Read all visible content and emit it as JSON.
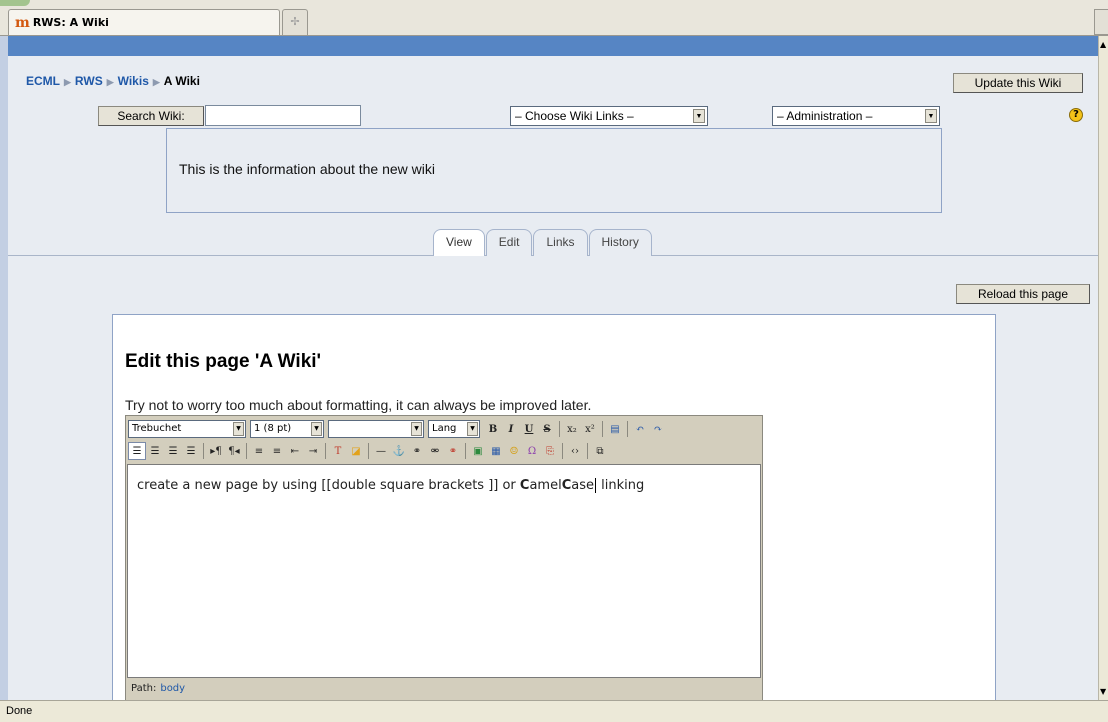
{
  "browser": {
    "tab_title": "RWS: A Wiki",
    "tab_logo": "m",
    "new_tab_icon": "✢",
    "status": "Done"
  },
  "breadcrumb": {
    "items": [
      "ECML",
      "RWS",
      "Wikis"
    ],
    "current": "A Wiki"
  },
  "header": {
    "update_button": "Update this Wiki",
    "search_button": "Search Wiki:",
    "search_value": "",
    "wiki_links_select": "– Choose Wiki Links –",
    "admin_select": "– Administration –",
    "help_icon": "?",
    "info_text": "This is the information about the new wiki"
  },
  "tabs": [
    {
      "label": "View",
      "active": true
    },
    {
      "label": "Edit",
      "active": false
    },
    {
      "label": "Links",
      "active": false
    },
    {
      "label": "History",
      "active": false
    }
  ],
  "reload_button": "Reload this page",
  "edit": {
    "title": "Edit this page 'A Wiki'",
    "hint": "Try not to worry too much about formatting, it can always be improved later.",
    "font_select": "Trebuchet",
    "size_select": "1 (8 pt)",
    "style_select": "",
    "lang_select": "Lang",
    "content_pre": "create a new page by using [[double square brackets ]] or ",
    "camel_c1": "C",
    "camel_mid": "amel",
    "camel_c2": "C",
    "camel_end": "ase",
    "content_post": " linking",
    "path_label": "Path:",
    "path_value": "body"
  },
  "toolbar_icons": {
    "row1": [
      "bold-icon",
      "italic-icon",
      "underline-icon",
      "strikethrough-icon",
      "subscript-icon",
      "superscript-icon",
      "paste-word-icon",
      "undo-icon",
      "redo-icon"
    ],
    "row2": [
      "align-left-icon",
      "align-center-icon",
      "align-right-icon",
      "justify-icon",
      "ltr-icon",
      "rtl-icon",
      "ordered-list-icon",
      "unordered-list-icon",
      "outdent-icon",
      "indent-icon",
      "text-color-icon",
      "bg-color-icon",
      "horizontal-rule-icon",
      "anchor-icon",
      "link-icon",
      "unlink-icon",
      "nolink-icon",
      "image-icon",
      "table-icon",
      "smiley-icon",
      "insert-char-icon",
      "search-replace-icon",
      "html-source-icon",
      "fullscreen-icon"
    ]
  },
  "colors": {
    "accent_bar": "#5685c4",
    "link": "#1f58a8",
    "page_bg": "#e8ecf2"
  }
}
